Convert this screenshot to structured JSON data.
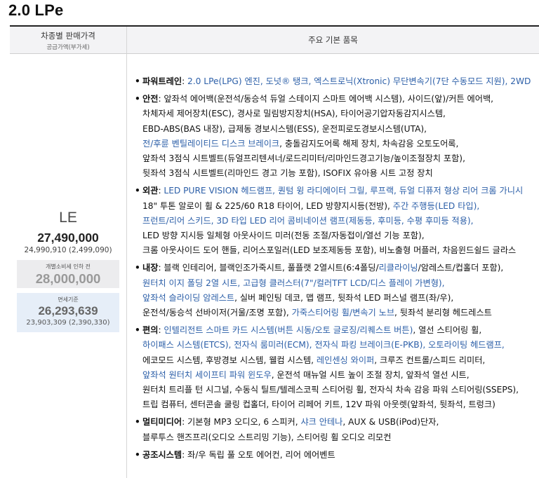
{
  "title": "2.0 LPe",
  "table_header": {
    "left_line1": "차종별 판매가격",
    "left_line2": "공급가액(부가세)",
    "right": "주요 기본 품목"
  },
  "trim": {
    "name": "LE",
    "price": "27,490,000",
    "price_sub": "24,990,910 (2,499,090)",
    "box1_label": "개별소비세 인하 전",
    "box1_value": "28,000,000",
    "box2_label": "면세기준",
    "box2_value": "26,293,639",
    "box2_sub": "23,903,309 (2,390,330)"
  },
  "features": [
    {
      "category": "파워트레인",
      "lines": [
        [
          {
            "t": ": "
          },
          {
            "t": "2.0 LPe(LPG) 엔진, 도넛® 탱크, 엑스트로닉(Xtronic) 무단변속기(7단 수동모드 지원), 2WD",
            "hl": true
          }
        ]
      ]
    },
    {
      "category": "안전",
      "lines": [
        [
          {
            "t": ": 앞좌석 에어백(운전석/동승석 듀얼 스테이지 스마트 에어백 시스템), 사이드(앞)/커튼 에어백,"
          }
        ],
        [
          {
            "t": "차체자세 제어장치(ESC), 경사로 밀림방지장치(HSA), 타이어공기압자동감지시스템,"
          }
        ],
        [
          {
            "t": "EBD-ABS(BAS 내장), 급제동 경보시스템(ESS), 운전피로도경보시스템(UTA),"
          }
        ],
        [
          {
            "t": "전/후륜 벤틸레이티드 디스크 브레이크",
            "hl": true
          },
          {
            "t": ", 충돌감지도어록 해제 장치, 차속감응 오토도어록,"
          }
        ],
        [
          {
            "t": "앞좌석 3점식 시트벨트(듀얼프리텐셔너/로드리미터/리마인드경고기능/높이조절장치 포함),"
          }
        ],
        [
          {
            "t": "뒷좌석 3점식 시트벨트(리마인드 경고 기능 포함), ISOFIX 유아용 시트 고정 장치"
          }
        ]
      ]
    },
    {
      "category": "외관",
      "lines": [
        [
          {
            "t": ": "
          },
          {
            "t": "LED PURE VISION 헤드램프, 퀀텀 윙 라디에이터 그릴, 루프랙, 듀얼 디퓨저 형상 리어 크롬 가니시",
            "hl": true
          }
        ],
        [
          {
            "t": "18\" 투톤 알로이 휠 & 225/60 R18 타이어, LED 방향지시등(전방), "
          },
          {
            "t": "주간 주행등(LED 타입),",
            "hl": true
          }
        ],
        [
          {
            "t": "프런트/리어 스키드, 3D 타입 LED 리어 콤비네이션 램프(제동등, 후미등, 수평 후미등 적용),",
            "hl": true
          }
        ],
        [
          {
            "t": "LED 방향 지시등 일체형 아웃사이드 미러(전동 조절/자동접이/열선 기능 포함),"
          }
        ],
        [
          {
            "t": "크롬 아웃사이드 도어 핸들, 리어스포일러(LED 보조제동등 포함), 비노출형 머플러, 차음윈드쉴드 글라스"
          }
        ]
      ]
    },
    {
      "category": "내장",
      "lines": [
        [
          {
            "t": ": 블랙 인테리어, 블랙인조가죽시트, 풀플랫 2열시트(6:4폴딩/"
          },
          {
            "t": "리클라이닝",
            "hl": true
          },
          {
            "t": "/암레스트/컵홀더 포함),"
          }
        ],
        [
          {
            "t": "원터치 이지 폴딩 2열 시트, 고급형 클러스터(7\"/컬러TFT LCD/디스 플레이 가변형),",
            "hl": true
          }
        ],
        [
          {
            "t": "앞좌석 슬라이딩 암레스트",
            "hl": true
          },
          {
            "t": ", 실버 페인팅 데코, 맵 램프, 뒷좌석 LED 퍼스널 램프(좌/우),"
          }
        ],
        [
          {
            "t": "운전석/동승석 선바이저(거울/조명 포함), "
          },
          {
            "t": "가죽스티어링 휠/변속기 노브",
            "hl": true
          },
          {
            "t": ", 뒷좌석 분리형 헤드레스트"
          }
        ]
      ]
    },
    {
      "category": "편의",
      "lines": [
        [
          {
            "t": ": "
          },
          {
            "t": "인텔리전트 스마트 카드 시스템(버튼 시동/오토 글로징/리퀘스트 버튼)",
            "hl": true
          },
          {
            "t": ", 열선 스티어링 휠,"
          }
        ],
        [
          {
            "t": "하이패스 시스템(ETCS), 전자식 룸미러(ECM), 전자식 파킹 브레이크(E-PKB), 오토라이팅 헤드램프,",
            "hl": true
          }
        ],
        [
          {
            "t": "에코모드 시스템, 후방경보 시스템, 웰컴 시스템, "
          },
          {
            "t": "레인센싱 와이퍼",
            "hl": true
          },
          {
            "t": ", 크루즈 컨트롤/스피드 리미터,"
          }
        ],
        [
          {
            "t": "앞좌석 원터치 세이프티 파워 윈도우",
            "hl": true
          },
          {
            "t": ", 운전석 매뉴얼 시트 높이 조절 장치, 앞좌석 열선 시트,"
          }
        ],
        [
          {
            "t": "원터치 트리플 턴 시그널, 수동식 틸트/텔레스코픽 스티어링 휠, 전자식 차속 감응 파워 스티어링(SSEPS),"
          }
        ],
        [
          {
            "t": "트립 컴퓨터, 센터콘솔 쿨링 컵홀더, 타이어 리페어 키트, 12V 파워 아웃렛(앞좌석, 뒷좌석, 트렁크)"
          }
        ]
      ]
    },
    {
      "category": "멀티미디어",
      "lines": [
        [
          {
            "t": ": 기본형 MP3 오디오, 6 스피커, "
          },
          {
            "t": "샤크 안테나",
            "hl": true
          },
          {
            "t": ", AUX & USB(iPod)단자,"
          }
        ],
        [
          {
            "t": "블루투스 핸즈프리(오디오 스트리밍 기능), 스티어링 휠 오디오 리모컨"
          }
        ]
      ]
    },
    {
      "category": "공조시스템",
      "lines": [
        [
          {
            "t": ": 좌/우 독립 풀 오토 에어컨, 리어 에어벤트"
          }
        ]
      ]
    }
  ]
}
